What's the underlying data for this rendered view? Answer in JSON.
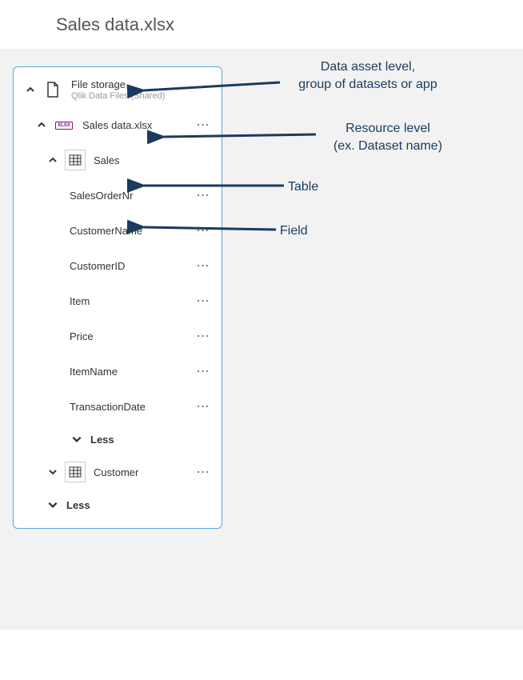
{
  "header": {
    "title": "Sales data.xlsx"
  },
  "tree": {
    "asset": {
      "label": "File storage",
      "sublabel": "Qlik Data Files (Shared)"
    },
    "resource": {
      "label": "Sales data.xlsx"
    },
    "table_sales": {
      "label": "Sales"
    },
    "fields": [
      {
        "label": "SalesOrderNr"
      },
      {
        "label": "CustomerName"
      },
      {
        "label": "CustomerID"
      },
      {
        "label": "Item"
      },
      {
        "label": "Price"
      },
      {
        "label": "ItemName"
      },
      {
        "label": "TransactionDate"
      }
    ],
    "less": "Less",
    "table_customer": {
      "label": "Customer"
    },
    "less2": "Less"
  },
  "annotations": {
    "asset": "Data asset level,\ngroup of datasets or app",
    "resource": "Resource level\n(ex. Dataset name)",
    "table": "Table",
    "field": "Field"
  }
}
